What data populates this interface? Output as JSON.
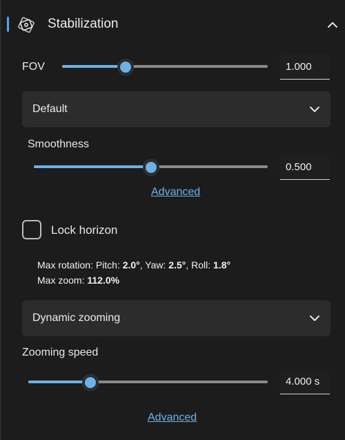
{
  "header": {
    "title": "Stabilization",
    "icon": "stabilization-icon",
    "collapse_icon": "chevron-up-icon"
  },
  "colors": {
    "accent": "#6cb2ea",
    "background": "#1c1c1c",
    "dropdown_bg": "#2c2c2c"
  },
  "fov": {
    "label": "FOV",
    "value": "1.000",
    "slider_fraction": 0.31
  },
  "preset_dropdown": {
    "selected": "Default"
  },
  "smoothness": {
    "label": "Smoothness",
    "value": "0.500",
    "slider_fraction": 0.5,
    "advanced_link": "Advanced"
  },
  "lock_horizon": {
    "label": "Lock horizon",
    "checked": false
  },
  "max_info": {
    "rotation_prefix": "Max rotation: Pitch: ",
    "pitch": "2.0°",
    "yaw_prefix": ", Yaw: ",
    "yaw": "2.5°",
    "roll_prefix": ", Roll: ",
    "roll": "1.8°",
    "zoom_prefix": "Max zoom: ",
    "zoom": "112.0%"
  },
  "zoom_dropdown": {
    "selected": "Dynamic zooming"
  },
  "zooming_speed": {
    "label": "Zooming speed",
    "value": "4.000 s",
    "slider_fraction": 0.26,
    "advanced_link": "Advanced"
  }
}
